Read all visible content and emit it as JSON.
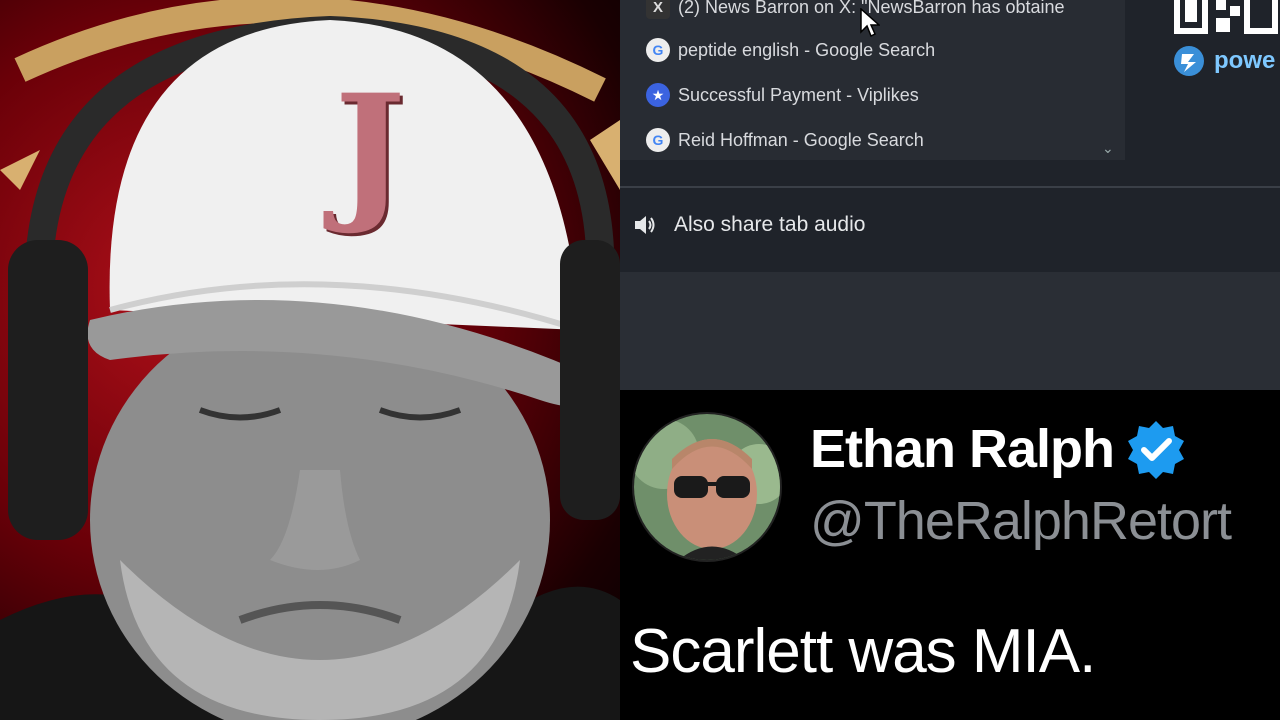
{
  "share_picker": {
    "tabs": [
      {
        "icon": "x-favicon",
        "glyph": "X",
        "label": "(2) News Barron on X: \"NewsBarron has obtaine"
      },
      {
        "icon": "google-favicon",
        "glyph": "G",
        "label": "peptide english - Google Search"
      },
      {
        "icon": "viplikes-favicon",
        "glyph": "★",
        "label": "Successful Payment - Viplikes"
      },
      {
        "icon": "google-favicon",
        "glyph": "G",
        "label": "Reid Hoffman - Google Search"
      }
    ],
    "audio_label": "Also share tab audio",
    "sponsor_text": "powe"
  },
  "tweet": {
    "display_name": "Ethan Ralph",
    "handle": "@TheRalphRetort",
    "text": "Scarlett was MIA."
  },
  "webcam": {
    "cap_logo": "J"
  },
  "colors": {
    "verified": "#1d9bf0",
    "panel_bg": "#282c33",
    "backdrop_red": "#b0101a"
  }
}
